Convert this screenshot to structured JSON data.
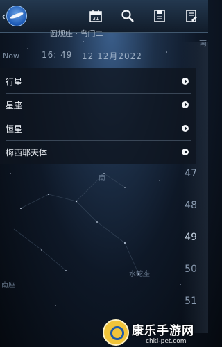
{
  "toolbar": {
    "icons": [
      "back-chevron",
      "app-logo",
      "calendar-icon",
      "search-icon",
      "save-icon",
      "notes-icon"
    ],
    "calendar_number": "31"
  },
  "header": {
    "map_title": "圆规座 · 鸟门二",
    "now_label": "Now",
    "time": "16: 49",
    "date": "12 12月2022",
    "side_label": "南"
  },
  "menu": {
    "items": [
      {
        "label": "行星"
      },
      {
        "label": "星座"
      },
      {
        "label": "恒星"
      },
      {
        "label": "梅西耶天体"
      }
    ]
  },
  "scale": {
    "numbers": [
      "47",
      "48",
      "49",
      "50",
      "51"
    ]
  },
  "sky": {
    "direction_label": "南",
    "constellation_label": "水蛇座",
    "left_label": "南座"
  },
  "watermark": {
    "text": "康乐手游网",
    "url": "chkl-pet.com"
  },
  "colors": {
    "accent": "#1b58b4",
    "menu_bg": "#0e151f",
    "divider": "#394656"
  }
}
